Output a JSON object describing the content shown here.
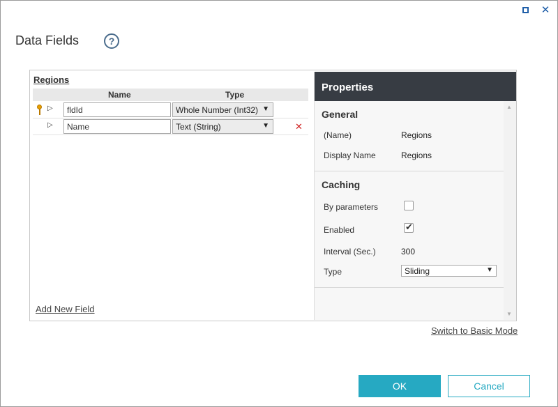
{
  "window": {
    "maximize_icon": "maximize-icon",
    "close_icon": "close-icon",
    "close_glyph": "✕"
  },
  "header": {
    "title": "Data Fields",
    "help_glyph": "?"
  },
  "table": {
    "name": "Regions",
    "columns": {
      "name": "Name",
      "type": "Type"
    },
    "rows": [
      {
        "primary_key": true,
        "expander": "▷",
        "name": "fldId",
        "type": "Whole Number (Int32)",
        "deletable": false
      },
      {
        "primary_key": false,
        "expander": "▷",
        "name": "Name",
        "type": "Text (String)",
        "deletable": true,
        "delete_glyph": "✕"
      }
    ],
    "select_arrow": "▼",
    "add_field_label": "Add New Field"
  },
  "properties": {
    "title": "Properties",
    "general": {
      "title": "General",
      "name_label": "(Name)",
      "name_value": "Regions",
      "display_name_label": "Display Name",
      "display_name_value": "Regions"
    },
    "caching": {
      "title": "Caching",
      "by_parameters_label": "By parameters",
      "by_parameters_checked": false,
      "enabled_label": "Enabled",
      "enabled_checked": true,
      "interval_label": "Interval (Sec.)",
      "interval_value": "300",
      "type_label": "Type",
      "type_value": "Sliding"
    },
    "scroll_up": "▲",
    "scroll_down": "▼"
  },
  "footer": {
    "switch_mode_label": "Switch to Basic Mode",
    "ok_label": "OK",
    "cancel_label": "Cancel"
  },
  "colors": {
    "accent": "#26a9c2",
    "properties_header": "#373c43",
    "delete": "#d02020",
    "key": "#e8a000"
  }
}
